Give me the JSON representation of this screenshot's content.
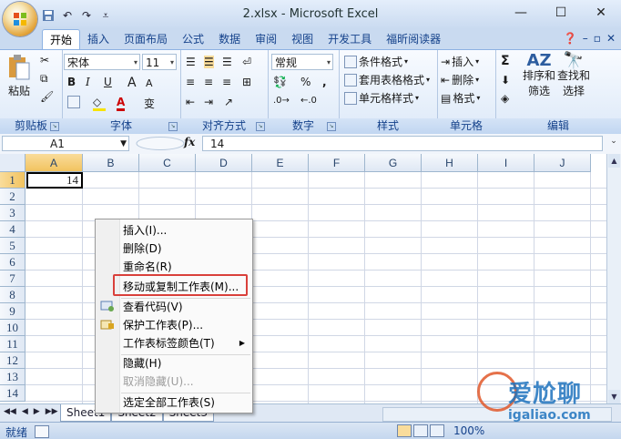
{
  "window": {
    "title": "2.xlsx - Microsoft Excel",
    "qat": [
      "save-icon",
      "undo-icon",
      "redo-icon",
      "customize-icon"
    ],
    "controls": [
      "minimize-icon",
      "maximize-icon",
      "close-icon"
    ]
  },
  "tabs": [
    "开始",
    "插入",
    "页面布局",
    "公式",
    "数据",
    "审阅",
    "视图",
    "开发工具",
    "福昕阅读器"
  ],
  "active_tab": "开始",
  "ribbon": {
    "clipboard": {
      "paste": "粘贴",
      "label": "剪贴板"
    },
    "font": {
      "name": "宋体",
      "size": "11",
      "bold": "B",
      "italic": "I",
      "underline": "U",
      "grow": "A",
      "shrink": "A",
      "color_a": "A",
      "phonetic": "变",
      "label": "字体"
    },
    "alignment": {
      "label": "对齐方式"
    },
    "number": {
      "format": "常规",
      "percent": "%",
      "comma": ",",
      "label": "数字"
    },
    "styles": {
      "conditional": "条件格式",
      "table": "套用表格格式",
      "cell_styles": "单元格样式",
      "label": "样式"
    },
    "cells": {
      "insert": "插入",
      "delete": "删除",
      "format": "格式",
      "label": "单元格"
    },
    "editing": {
      "sigma": "Σ",
      "sort": "排序和",
      "sort2": "筛选",
      "find": "查找和",
      "find2": "选择",
      "label": "编辑"
    }
  },
  "formula_bar": {
    "name_box": "A1",
    "fx": "fx",
    "value": "14"
  },
  "grid": {
    "columns": [
      "A",
      "B",
      "C",
      "D",
      "E",
      "F",
      "G",
      "H",
      "I",
      "J"
    ],
    "rows": [
      "1",
      "2",
      "3",
      "4",
      "5",
      "6",
      "7",
      "8",
      "9",
      "10",
      "11",
      "12",
      "13",
      "14"
    ],
    "cell_a1": "14"
  },
  "context_menu": {
    "items": [
      "插入(I)...",
      "删除(D)",
      "重命名(R)",
      "移动或复制工作表(M)...",
      "查看代码(V)",
      "保护工作表(P)...",
      "工作表标签颜色(T)",
      "隐藏(H)",
      "取消隐藏(U)...",
      "选定全部工作表(S)"
    ],
    "highlighted": "移动或复制工作表(M)..."
  },
  "sheet_tabs": [
    "Sheet1",
    "Sheet2",
    "Sheet3"
  ],
  "status": {
    "text": "就绪",
    "zoom": "100%"
  },
  "watermark": {
    "text": "爱尬聊",
    "url": "igaliao.com"
  }
}
